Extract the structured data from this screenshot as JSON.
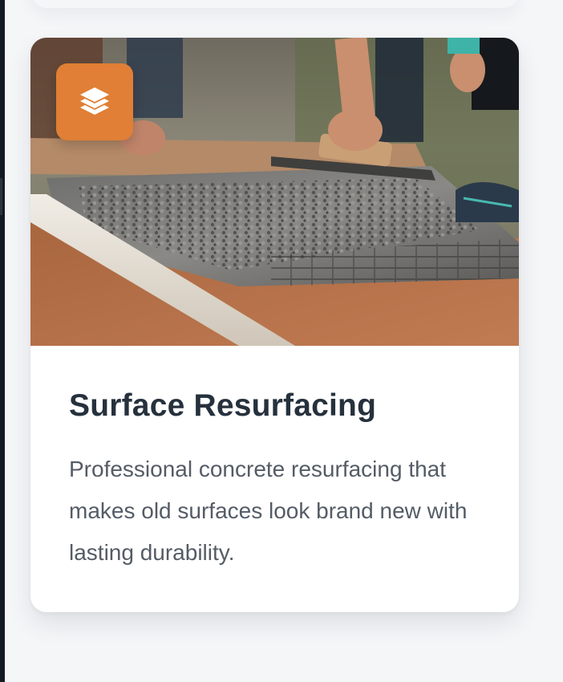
{
  "card": {
    "icon": "layers-icon",
    "accent_color": "#e07f35",
    "title": "Surface Resurfacing",
    "description": "Professional concrete resurfacing that makes old surfaces look brand new with lasting durability."
  }
}
